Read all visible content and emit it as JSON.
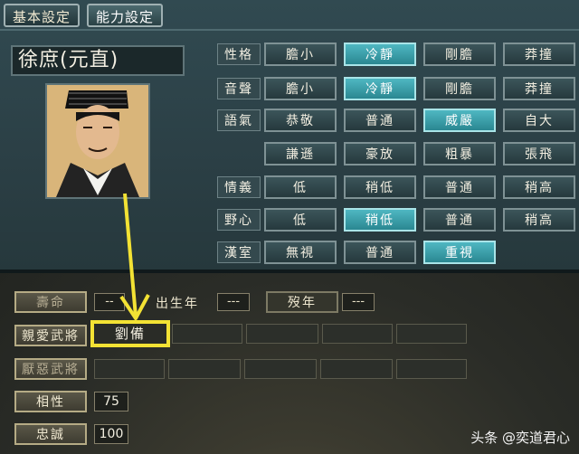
{
  "tabs": [
    "基本設定",
    "能力設定"
  ],
  "character": {
    "name": "徐庶(元直)"
  },
  "traits": [
    {
      "label": "性格",
      "options": [
        "膽小",
        "冷靜",
        "剛膽",
        "莽撞"
      ],
      "selected": 1
    },
    {
      "label": "音聲",
      "options": [
        "膽小",
        "冷靜",
        "剛膽",
        "莽撞"
      ],
      "selected": 1
    },
    {
      "label": "語氣",
      "options": [
        "恭敬",
        "普通",
        "威嚴",
        "自大"
      ],
      "selected": 2
    },
    {
      "label": "",
      "options": [
        "謙遜",
        "豪放",
        "粗暴",
        "張飛"
      ],
      "selected": -1
    },
    {
      "label": "情義",
      "options": [
        "低",
        "稍低",
        "普通",
        "稍高"
      ],
      "selected": -1
    },
    {
      "label": "野心",
      "options": [
        "低",
        "稍低",
        "普通",
        "稍高"
      ],
      "selected": 1
    },
    {
      "label": "漢室",
      "options": [
        "無視",
        "普通",
        "重視"
      ],
      "selected": 2
    }
  ],
  "life": {
    "lifespan_label": "壽命",
    "lifespan_value": "--",
    "birth_label": "出生年",
    "birth_value": "---",
    "death_label": "歿年",
    "death_value": "---"
  },
  "relations": {
    "liked_label": "親愛武將",
    "liked_first": "劉備",
    "disliked_label": "厭惡武將"
  },
  "compat": {
    "label": "相性",
    "value": "75"
  },
  "loyalty": {
    "label": "忠誠",
    "value": "100"
  },
  "watermark": "头条 @奕道君心",
  "colors": {
    "selected": "#3aa6b2",
    "highlight": "#f3e234"
  }
}
